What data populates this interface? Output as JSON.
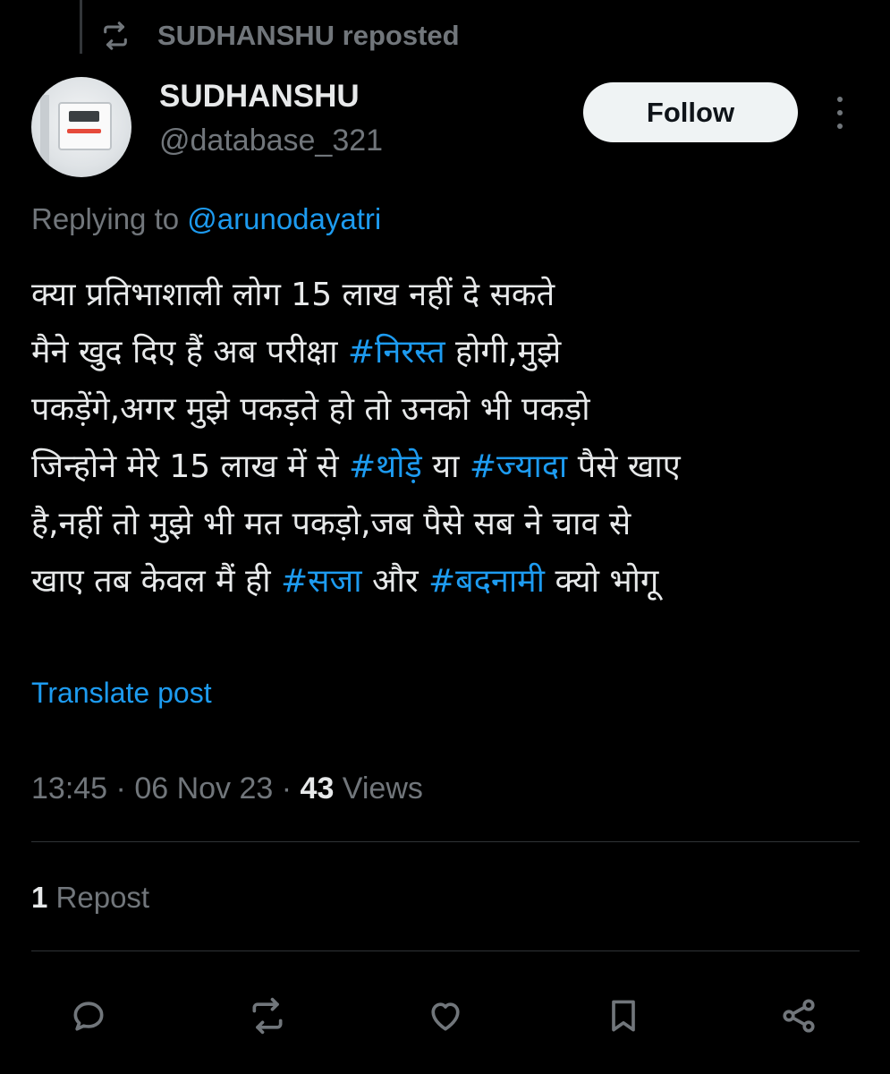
{
  "repost_header": {
    "text": "SUDHANSHU reposted",
    "icon": "repost-icon"
  },
  "author": {
    "name": "SUDHANSHU",
    "handle": "@database_321",
    "avatar": "avatar-device-photo"
  },
  "follow_label": "Follow",
  "replying": {
    "prefix": "Replying to ",
    "mention": "@arunodayatri"
  },
  "post": {
    "lines": [
      {
        "segments": [
          {
            "text": "क्या प्रतिभाशाली लोग 15 लाख नहीं दे सकते",
            "tag": false
          }
        ]
      },
      {
        "segments": [
          {
            "text": "मैने खुद दिए हैं अब परीक्षा ",
            "tag": false
          },
          {
            "text": "#निरस्त",
            "tag": true
          },
          {
            "text": " होगी,मुझे",
            "tag": false
          }
        ]
      },
      {
        "segments": [
          {
            "text": "पकड़ेंगे,अगर मुझे पकड़ते हो तो उनको भी पकड़ो",
            "tag": false
          }
        ]
      },
      {
        "segments": [
          {
            "text": "जिन्होने मेरे 15 लाख में से ",
            "tag": false
          },
          {
            "text": "#थोड़े",
            "tag": true
          },
          {
            "text": " या ",
            "tag": false
          },
          {
            "text": "#ज्यादा",
            "tag": true
          },
          {
            "text": " पैसे खाए",
            "tag": false
          }
        ]
      },
      {
        "segments": [
          {
            "text": "है,नहीं तो मुझे भी मत पकड़ो,जब पैसे सब ने चाव से",
            "tag": false
          }
        ]
      },
      {
        "segments": [
          {
            "text": "खाए तब केवल मैं ही ",
            "tag": false
          },
          {
            "text": "#सजा",
            "tag": true
          },
          {
            "text": " और ",
            "tag": false
          },
          {
            "text": "#बदनामी",
            "tag": true
          },
          {
            "text": " क्यो भोगू",
            "tag": false
          }
        ]
      }
    ]
  },
  "translate_label": "Translate post",
  "meta": {
    "time": "13:45",
    "sep1": " · ",
    "date": "06 Nov 23",
    "sep2": " · ",
    "views_count": "43",
    "views_label": " Views"
  },
  "reposts": {
    "count": "1",
    "label": " Repost"
  },
  "actions": [
    {
      "name": "reply-icon"
    },
    {
      "name": "repost-icon"
    },
    {
      "name": "like-icon"
    },
    {
      "name": "bookmark-icon"
    },
    {
      "name": "share-icon"
    }
  ],
  "colors": {
    "background": "#000000",
    "text": "#e7e9ea",
    "muted": "#71767b",
    "link": "#1d9bf0",
    "button_bg": "#eff3f4"
  }
}
